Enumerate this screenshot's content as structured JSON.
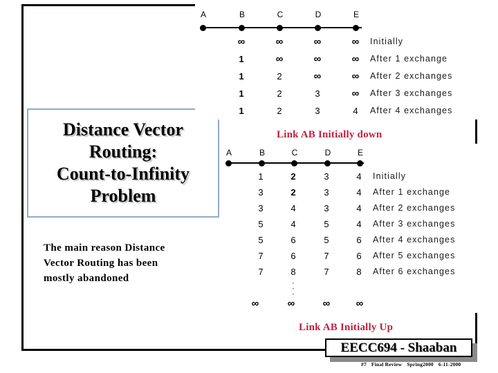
{
  "slide": {
    "title_lines": [
      "Distance Vector",
      "Routing:",
      "Count-to-Infinity",
      "Problem"
    ],
    "note_lines": [
      "The main reason Distance",
      "Vector Routing has been",
      "mostly abandoned"
    ],
    "accent_red": "#c2203f",
    "frame_color": "#000000",
    "title_box_border": "#93aac9"
  },
  "diagram_top": {
    "caption": "Link AB Initially down",
    "nodes": [
      "A",
      "B",
      "C",
      "D",
      "E"
    ],
    "columns": [
      "B",
      "C",
      "D",
      "E"
    ],
    "rows": [
      {
        "label": "Initially",
        "values": [
          "∞",
          "∞",
          "∞",
          "∞"
        ]
      },
      {
        "label": "After 1 exchange",
        "values": [
          "1",
          "∞",
          "∞",
          "∞"
        ]
      },
      {
        "label": "After 2 exchanges",
        "values": [
          "1",
          "2",
          "∞",
          "∞"
        ]
      },
      {
        "label": "After 3 exchanges",
        "values": [
          "1",
          "2",
          "3",
          "∞"
        ]
      },
      {
        "label": "After 4 exchanges",
        "values": [
          "1",
          "2",
          "3",
          "4"
        ]
      }
    ]
  },
  "diagram_bottom": {
    "caption": "Link AB Initially Up",
    "nodes": [
      "A",
      "B",
      "C",
      "D",
      "E"
    ],
    "columns": [
      "B",
      "C",
      "D",
      "E"
    ],
    "rows": [
      {
        "label": "Initially",
        "values": [
          "1",
          "2",
          "3",
          "4"
        ]
      },
      {
        "label": "After 1 exchange",
        "values": [
          "3",
          "2",
          "3",
          "4"
        ]
      },
      {
        "label": "After 2 exchanges",
        "values": [
          "3",
          "4",
          "3",
          "4"
        ]
      },
      {
        "label": "After 3 exchanges",
        "values": [
          "5",
          "4",
          "5",
          "4"
        ]
      },
      {
        "label": "After 4 exchanges",
        "values": [
          "5",
          "6",
          "5",
          "6"
        ]
      },
      {
        "label": "After 5 exchanges",
        "values": [
          "7",
          "6",
          "7",
          "6"
        ]
      },
      {
        "label": "After 6 exchanges",
        "values": [
          "7",
          "8",
          "7",
          "8"
        ]
      }
    ],
    "ellipsis": "·",
    "final_row": {
      "label": "",
      "values": [
        "∞",
        "∞",
        "∞",
        "∞"
      ]
    }
  },
  "footer": {
    "badge_text": "EECC694 - Shaaban",
    "sub_part": "#7",
    "sub_title": "Final Review",
    "sub_term": "Spring2000",
    "sub_date": "6-11-2000"
  },
  "chart_data": {
    "type": "table",
    "title": "Distance Vector Routing: Count-to-Infinity Problem",
    "tables": [
      {
        "name": "Link AB Initially down",
        "columns": [
          "B",
          "C",
          "D",
          "E"
        ],
        "row_labels": [
          "Initially",
          "After 1 exchange",
          "After 2 exchanges",
          "After 3 exchanges",
          "After 4 exchanges"
        ],
        "values": [
          [
            "∞",
            "∞",
            "∞",
            "∞"
          ],
          [
            "1",
            "∞",
            "∞",
            "∞"
          ],
          [
            "1",
            "2",
            "∞",
            "∞"
          ],
          [
            "1",
            "2",
            "3",
            "∞"
          ],
          [
            "1",
            "2",
            "3",
            "4"
          ]
        ]
      },
      {
        "name": "Link AB Initially Up",
        "columns": [
          "B",
          "C",
          "D",
          "E"
        ],
        "row_labels": [
          "Initially",
          "After 1 exchange",
          "After 2 exchanges",
          "After 3 exchanges",
          "After 4 exchanges",
          "After 5 exchanges",
          "After 6 exchanges",
          "⋮",
          ""
        ],
        "values": [
          [
            "1",
            "2",
            "3",
            "4"
          ],
          [
            "3",
            "2",
            "3",
            "4"
          ],
          [
            "3",
            "4",
            "3",
            "4"
          ],
          [
            "5",
            "4",
            "5",
            "4"
          ],
          [
            "5",
            "6",
            "5",
            "6"
          ],
          [
            "7",
            "6",
            "7",
            "6"
          ],
          [
            "7",
            "8",
            "7",
            "8"
          ],
          [
            "",
            "",
            "",
            ""
          ],
          [
            "∞",
            "∞",
            "∞",
            "∞"
          ]
        ]
      }
    ]
  }
}
